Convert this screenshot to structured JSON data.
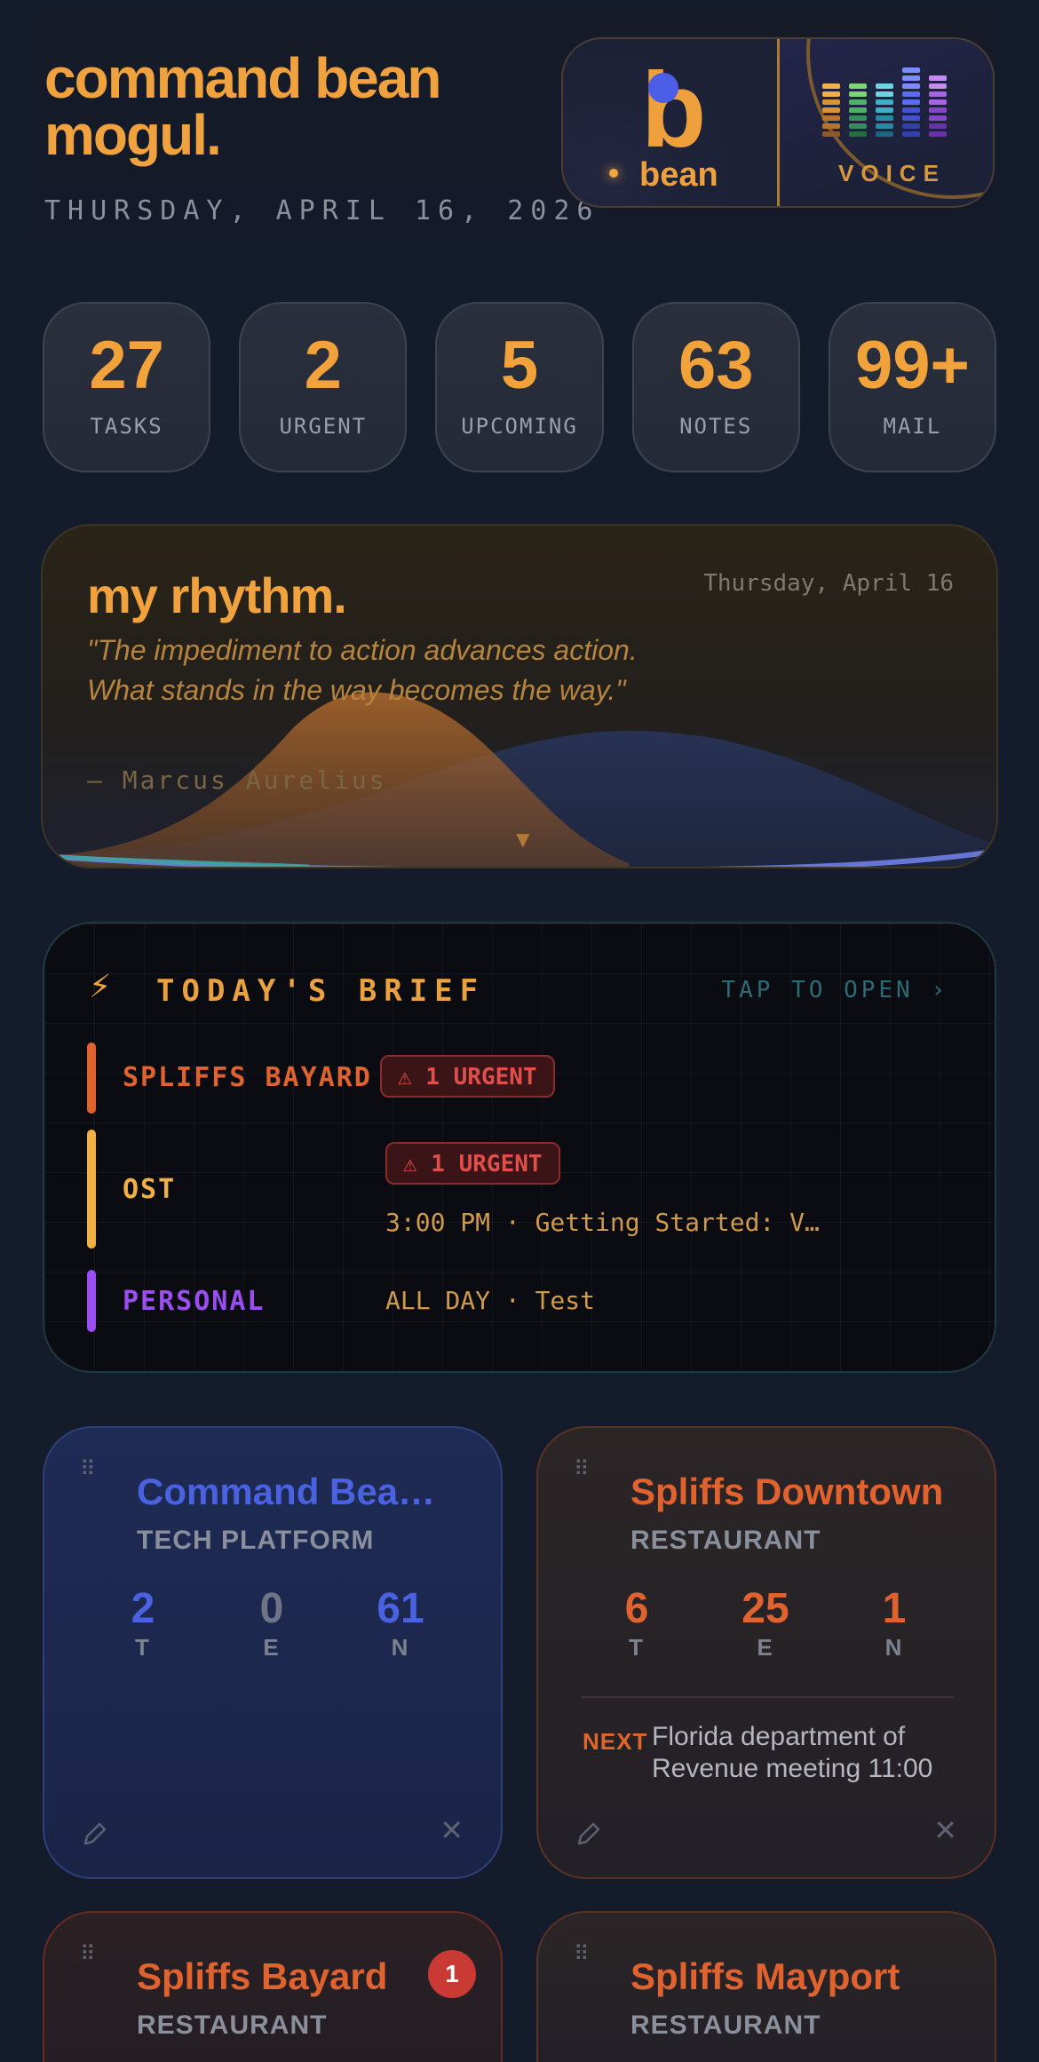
{
  "header": {
    "title": "command bean mogul.",
    "date": "THURSDAY, APRIL 16, 2026",
    "logo": {
      "letter": "b",
      "wordmark": "bean"
    },
    "voice_label": "VOICE"
  },
  "stats": [
    {
      "value": "27",
      "label": "TASKS"
    },
    {
      "value": "2",
      "label": "URGENT"
    },
    {
      "value": "5",
      "label": "UPCOMING"
    },
    {
      "value": "63",
      "label": "NOTES"
    },
    {
      "value": "99+",
      "label": "MAIL"
    }
  ],
  "rhythm": {
    "title": "my rhythm.",
    "date": "Thursday, April 16",
    "quote": "\"The impediment to action advances action. What stands in the way becomes the way.\"",
    "author": "— Marcus Aurelius",
    "expand_icon": "▼"
  },
  "brief": {
    "icon": "⚡",
    "title": "TODAY'S BRIEF",
    "open_label": "TAP TO OPEN ›",
    "rows": [
      {
        "name": "SPLIFFS BAYARD",
        "color": "#e0632f",
        "urgent": "⚠ 1 URGENT",
        "detail": ""
      },
      {
        "name": "OST",
        "color": "#f0b043",
        "urgent": "⚠ 1 URGENT",
        "detail": "3:00 PM · Getting Started: V…"
      },
      {
        "name": "PERSONAL",
        "color": "#9b4ef0",
        "urgent": "",
        "detail": "ALL DAY · Test"
      }
    ]
  },
  "cards": [
    {
      "name": "Command Bea…",
      "type": "TECH PLATFORM",
      "accent": "#4a62e0",
      "stats": [
        {
          "value": "2",
          "label": "T"
        },
        {
          "value": "0",
          "label": "E"
        },
        {
          "value": "61",
          "label": "N"
        }
      ]
    },
    {
      "name": "Spliffs Downtown",
      "type": "RESTAURANT",
      "accent": "#e0632f",
      "stats": [
        {
          "value": "6",
          "label": "T"
        },
        {
          "value": "25",
          "label": "E"
        },
        {
          "value": "1",
          "label": "N"
        }
      ],
      "next_label": "NEXT",
      "next_text": "Florida department of Revenue meeting 11:00"
    },
    {
      "name": "Spliffs Bayard",
      "type": "RESTAURANT",
      "accent": "#e0632f",
      "badge": "1"
    },
    {
      "name": "Spliffs Mayport",
      "type": "RESTAURANT",
      "accent": "#e0632f"
    }
  ],
  "icons": {
    "grip": "drag-handle-icon",
    "edit": "pencil-icon",
    "close": "close-icon",
    "bolt": "lightning-icon",
    "warning": "warning-icon"
  }
}
